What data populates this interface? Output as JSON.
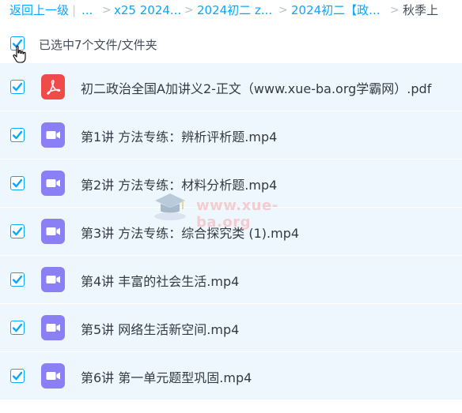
{
  "breadcrumb": {
    "back": "返回上一级",
    "bar": "|",
    "ellipsis": "...",
    "sep": ">",
    "items": [
      "x25 2024...",
      "2024初二 z...",
      "2024初二【政..."
    ],
    "current": "秋季上"
  },
  "selection": {
    "text": "已选中7个文件/文件夹",
    "checked": true
  },
  "files": [
    {
      "name": "初二政治全国A加讲义2-正文（www.xue-ba.org学霸网）.pdf",
      "icon": "pdf-icon",
      "checked": true
    },
    {
      "name": "第1讲 方法专练：辨析评析题.mp4",
      "icon": "video-icon",
      "checked": true
    },
    {
      "name": "第2讲 方法专练：材料分析题.mp4",
      "icon": "video-icon",
      "checked": true
    },
    {
      "name": "第3讲 方法专练：综合探究类 (1).mp4",
      "icon": "video-icon",
      "checked": true
    },
    {
      "name": "第4讲 丰富的社会生活.mp4",
      "icon": "video-icon",
      "checked": true
    },
    {
      "name": "第5讲 网络生活新空间.mp4",
      "icon": "video-icon",
      "checked": true
    },
    {
      "name": "第6讲 第一单元题型巩固.mp4",
      "icon": "video-icon",
      "checked": true
    }
  ],
  "watermark": {
    "text": "www.xue-ba.org"
  },
  "colors": {
    "accent": "#06a7ff",
    "row_bg": "#eef7fe",
    "pdf": "#f04b4b",
    "video": "#8a7ff5"
  }
}
